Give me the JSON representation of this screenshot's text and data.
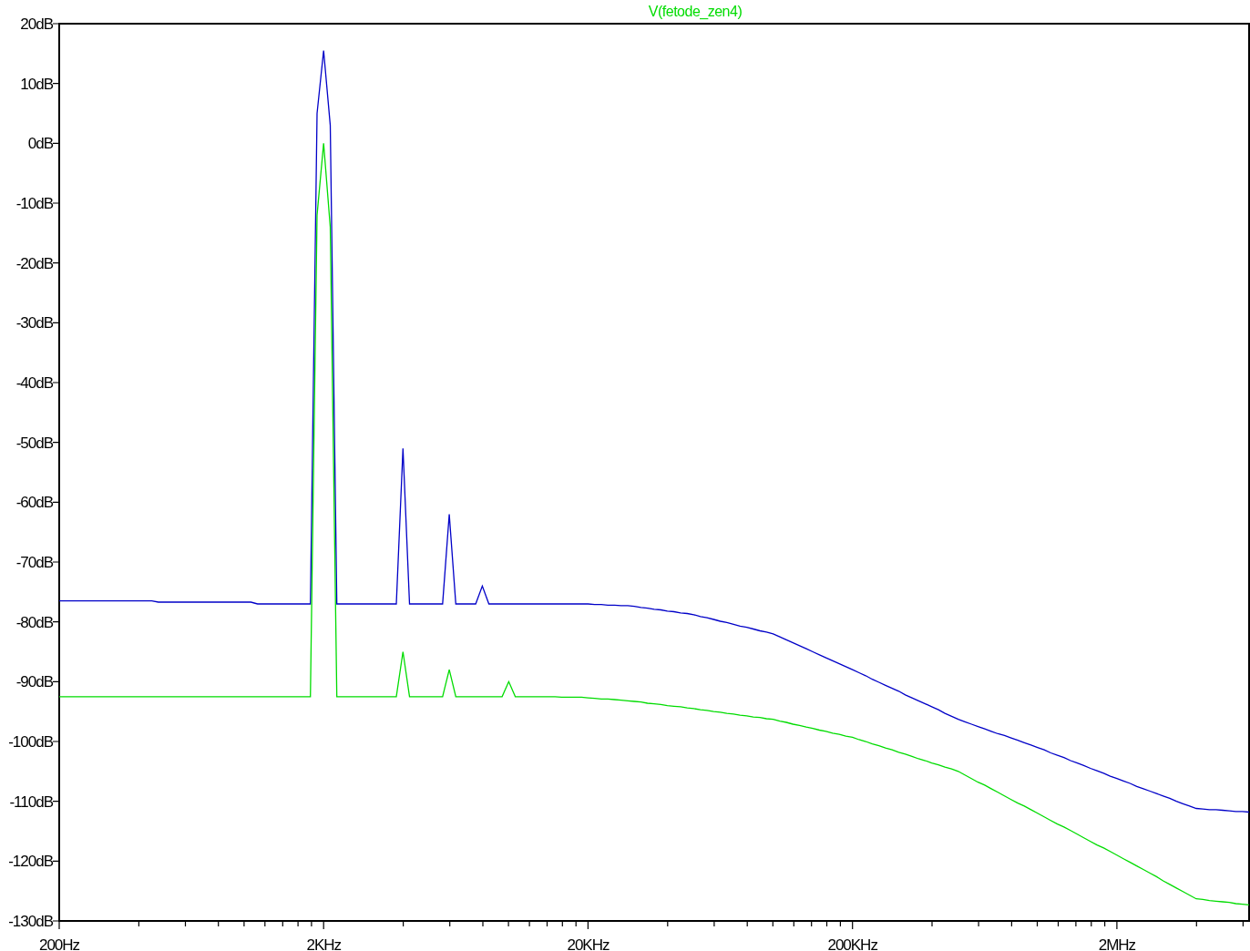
{
  "chart_data": {
    "type": "line",
    "categories": [
      "200Hz",
      null,
      null,
      null,
      null,
      null,
      null,
      null,
      null,
      null,
      null,
      null,
      null,
      null,
      null,
      null,
      null,
      null,
      null,
      null,
      null,
      null,
      null,
      null,
      null,
      null,
      null,
      null,
      null,
      null,
      null,
      null,
      null,
      null,
      null,
      null,
      null,
      null,
      null,
      null,
      "2KHz",
      null,
      null,
      null,
      null,
      null,
      null,
      null,
      null,
      null,
      null,
      null,
      null,
      null,
      null,
      null,
      null,
      null,
      null,
      null,
      null,
      null,
      null,
      null,
      null,
      null,
      null,
      null,
      null,
      null,
      null,
      null,
      null,
      null,
      null,
      null,
      null,
      null,
      null,
      null,
      "20KHz",
      null,
      null,
      null,
      null,
      null,
      null,
      null,
      null,
      null,
      null,
      null,
      null,
      null,
      null,
      null,
      null,
      null,
      null,
      null,
      null,
      null,
      null,
      null,
      null,
      null,
      null,
      null,
      null,
      null,
      null,
      null,
      null,
      null,
      null,
      null,
      null,
      null,
      null,
      null,
      "200KHz",
      null,
      null,
      null,
      null,
      null,
      null,
      null,
      null,
      null,
      null,
      null,
      null,
      null,
      null,
      null,
      null,
      null,
      null,
      null,
      null,
      null,
      null,
      null,
      null,
      null,
      null,
      null,
      null,
      null,
      null,
      null,
      null,
      null,
      null,
      null,
      null,
      null,
      null,
      null,
      "2MHz",
      null,
      null,
      null,
      null,
      null,
      null,
      null,
      null,
      null,
      null,
      null,
      null,
      null,
      null,
      null,
      null,
      null,
      null,
      null,
      null
    ],
    "series": [
      {
        "color": "#0000c8",
        "values": [
          -76.5,
          -76.5,
          -76.5,
          -76.5,
          -76.5,
          -76.5,
          -76.5,
          -76.5,
          -76.5,
          -76.5,
          -76.5,
          -76.5,
          -76.5,
          -76.5,
          -76.5,
          -76.7,
          -76.7,
          -76.7,
          -76.7,
          -76.7,
          -76.7,
          -76.7,
          -76.7,
          -76.7,
          -76.7,
          -76.7,
          -76.7,
          -76.7,
          -76.7,
          -76.7,
          -77,
          -77,
          -77,
          -77,
          -77,
          -77,
          -77,
          -77,
          -77,
          5,
          15.5,
          3,
          -77,
          -77,
          -77,
          -77,
          -77,
          -77,
          -77,
          -77,
          -77,
          -77,
          -51,
          -77,
          -77,
          -77,
          -77,
          -77,
          -77,
          -62,
          -77,
          -77,
          -77,
          -77,
          -74,
          -77,
          -77,
          -77,
          -77,
          -77,
          -77,
          -77,
          -77,
          -77,
          -77,
          -77,
          -77,
          -77,
          -77,
          -77,
          -77,
          -77.1,
          -77.1,
          -77.2,
          -77.2,
          -77.3,
          -77.3,
          -77.4,
          -77.6,
          -77.7,
          -77.9,
          -78.0,
          -78.2,
          -78.3,
          -78.5,
          -78.6,
          -78.8,
          -79.1,
          -79.3,
          -79.6,
          -79.9,
          -80.1,
          -80.4,
          -80.7,
          -80.9,
          -81.2,
          -81.5,
          -81.7,
          -82,
          -82.5,
          -83,
          -83.5,
          -84,
          -84.5,
          -85,
          -85.5,
          -86,
          -86.5,
          -87,
          -87.5,
          -88,
          -88.5,
          -89.0,
          -89.6,
          -90.1,
          -90.6,
          -91.1,
          -91.6,
          -92.2,
          -92.7,
          -93.2,
          -93.7,
          -94.2,
          -94.7,
          -95.3,
          -95.8,
          -96.3,
          -96.7,
          -97.1,
          -97.5,
          -97.9,
          -98.3,
          -98.7,
          -99.0,
          -99.4,
          -99.8,
          -100.2,
          -100.6,
          -101,
          -101.4,
          -101.9,
          -102.3,
          -102.7,
          -103.2,
          -103.6,
          -104.0,
          -104.5,
          -104.9,
          -105.3,
          -105.8,
          -106.2,
          -106.6,
          -107.0,
          -107.5,
          -107.9,
          -108.3,
          -108.7,
          -109.1,
          -109.5,
          -110.0,
          -110.4,
          -110.8,
          -111.2,
          -111.3,
          -111.4,
          -111.4,
          -111.5,
          -111.6,
          -111.7,
          -111.7,
          -111.8
        ]
      },
      {
        "name": "V(fetode_zen4)",
        "color": "#00dc00",
        "values": [
          -92.5,
          -92.5,
          -92.5,
          -92.5,
          -92.5,
          -92.5,
          -92.5,
          -92.5,
          -92.5,
          -92.5,
          -92.5,
          -92.5,
          -92.5,
          -92.5,
          -92.5,
          -92.5,
          -92.5,
          -92.5,
          -92.5,
          -92.5,
          -92.5,
          -92.5,
          -92.5,
          -92.5,
          -92.5,
          -92.5,
          -92.5,
          -92.5,
          -92.5,
          -92.5,
          -92.5,
          -92.5,
          -92.5,
          -92.5,
          -92.5,
          -92.5,
          -92.5,
          -92.5,
          -92.5,
          -12,
          0,
          -14,
          -92.5,
          -92.5,
          -92.5,
          -92.5,
          -92.5,
          -92.5,
          -92.5,
          -92.5,
          -92.5,
          -92.5,
          -85,
          -92.5,
          -92.5,
          -92.5,
          -92.5,
          -92.5,
          -92.5,
          -88,
          -92.5,
          -92.5,
          -92.5,
          -92.5,
          -92.5,
          -92.5,
          -92.5,
          -92.5,
          -90,
          -92.5,
          -92.5,
          -92.5,
          -92.5,
          -92.5,
          -92.5,
          -92.5,
          -92.6,
          -92.6,
          -92.6,
          -92.6,
          -92.7,
          -92.8,
          -92.9,
          -92.9,
          -93.0,
          -93.1,
          -93.2,
          -93.3,
          -93.4,
          -93.6,
          -93.7,
          -93.8,
          -94.0,
          -94.1,
          -94.2,
          -94.4,
          -94.5,
          -94.7,
          -94.8,
          -95.0,
          -95.1,
          -95.3,
          -95.4,
          -95.6,
          -95.7,
          -95.9,
          -96.0,
          -96.2,
          -96.3,
          -96.6,
          -96.8,
          -97.1,
          -97.3,
          -97.6,
          -97.8,
          -98.1,
          -98.3,
          -98.6,
          -98.8,
          -99.1,
          -99.3,
          -99.7,
          -100.0,
          -100.4,
          -100.7,
          -101.1,
          -101.4,
          -101.8,
          -102.1,
          -102.5,
          -102.9,
          -103.2,
          -103.6,
          -103.9,
          -104.3,
          -104.6,
          -105,
          -105.6,
          -106.2,
          -106.8,
          -107.3,
          -107.9,
          -108.5,
          -109.1,
          -109.7,
          -110.3,
          -110.8,
          -111.4,
          -112,
          -112.6,
          -113.2,
          -113.8,
          -114.3,
          -114.9,
          -115.5,
          -116.1,
          -116.7,
          -117.3,
          -117.8,
          -118.4,
          -119,
          -119.6,
          -120.2,
          -120.8,
          -121.4,
          -122.0,
          -122.6,
          -123.3,
          -123.9,
          -124.5,
          -125.1,
          -125.7,
          -126.3,
          -126.4,
          -126.6,
          -126.7,
          -126.8,
          -126.9,
          -127.1,
          -127.2,
          -127.3
        ]
      }
    ],
    "ylim": [
      -130,
      20
    ],
    "yticks": [
      {
        "value": 20,
        "label": "20dB"
      },
      {
        "value": 10,
        "label": "10dB"
      },
      {
        "value": 0,
        "label": "0dB"
      },
      {
        "value": -10,
        "label": "-10dB"
      },
      {
        "value": -20,
        "label": "-20dB"
      },
      {
        "value": -30,
        "label": "-30dB"
      },
      {
        "value": -40,
        "label": "-40dB"
      },
      {
        "value": -50,
        "label": "-50dB"
      },
      {
        "value": -60,
        "label": "-60dB"
      },
      {
        "value": -70,
        "label": "-70dB"
      },
      {
        "value": -80,
        "label": "-80dB"
      },
      {
        "value": -90,
        "label": "-90dB"
      },
      {
        "value": -100,
        "label": "-100dB"
      },
      {
        "value": -110,
        "label": "-110dB"
      },
      {
        "value": -120,
        "label": "-120dB"
      },
      {
        "value": -130,
        "label": "-130dB"
      }
    ]
  }
}
